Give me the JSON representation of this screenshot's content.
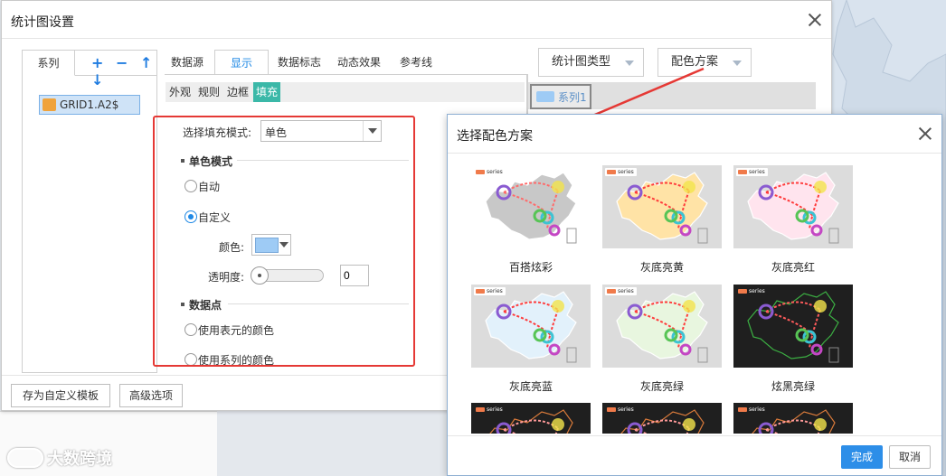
{
  "main_dialog": {
    "title": "统计图设置",
    "series_tab": "系列",
    "series_tools": "+ − ↑ ↓",
    "series_item": "GRID1.A2$",
    "tabs": [
      "数据源",
      "显示",
      "数据标志",
      "动态效果",
      "参考线"
    ],
    "sub_tabs": [
      "外观",
      "规则",
      "边框",
      "填充"
    ],
    "fill_mode_label": "选择填充模式:",
    "fill_mode_value": "单色",
    "single_color_section": "单色模式",
    "radio_auto": "自动",
    "radio_custom": "自定义",
    "color_label": "颜色:",
    "color_value": "#9ecbf5",
    "opacity_label": "透明度:",
    "opacity_value": "0",
    "data_point_section": "数据点",
    "radio_cell_color": "使用表元的颜色",
    "radio_series_color": "使用系列的颜色",
    "chart_type_button": "统计图类型",
    "color_scheme_button": "配色方案",
    "legend_item": "系列1",
    "save_template_button": "存为自定义模板",
    "advanced_button": "高级选项"
  },
  "scheme_dialog": {
    "title": "选择配色方案",
    "schemes": [
      {
        "name": "百搭炫彩",
        "bg": "#ffffff",
        "map": "#c8c8c8",
        "line": "#ff6a6a",
        "tag_bg": "#ffffff",
        "tag_fg": "#333"
      },
      {
        "name": "灰底亮黄",
        "bg": "#dcdcdc",
        "map": "#ffe3a6",
        "line": "#ff3b3b",
        "tag_bg": "#ffffff",
        "tag_fg": "#333"
      },
      {
        "name": "灰底亮红",
        "bg": "#dcdcdc",
        "map": "#ffe4ee",
        "line": "#ff3b3b",
        "tag_bg": "#ffffff",
        "tag_fg": "#333"
      },
      {
        "name": "灰底亮蓝",
        "bg": "#dcdcdc",
        "map": "#e2f1fb",
        "line": "#ff3b3b",
        "tag_bg": "#ffffff",
        "tag_fg": "#333"
      },
      {
        "name": "灰底亮绿",
        "bg": "#dcdcdc",
        "map": "#e8f6df",
        "line": "#ff3b3b",
        "tag_bg": "#ffffff",
        "tag_fg": "#333"
      },
      {
        "name": "炫黑亮绿",
        "bg": "#1f1f1f",
        "map": "#1f1f1f",
        "line": "#ff5b5b",
        "tag_bg": "#1f1f1f",
        "tag_fg": "#fff"
      },
      {
        "name": "",
        "bg": "#1f1f1f",
        "map": "#1f1f1f",
        "line": "#ff9a9a",
        "tag_bg": "#1f1f1f",
        "tag_fg": "#fff"
      },
      {
        "name": "",
        "bg": "#1f1f1f",
        "map": "#1f1f1f",
        "line": "#ff9a9a",
        "tag_bg": "#1f1f1f",
        "tag_fg": "#fff"
      },
      {
        "name": "",
        "bg": "#1f1f1f",
        "map": "#1f1f1f",
        "line": "#ff9a9a",
        "tag_bg": "#1f1f1f",
        "tag_fg": "#fff"
      }
    ],
    "series_tag_text": "series",
    "ok_button": "完成",
    "cancel_button": "取消"
  },
  "watermark": "大数跨境"
}
